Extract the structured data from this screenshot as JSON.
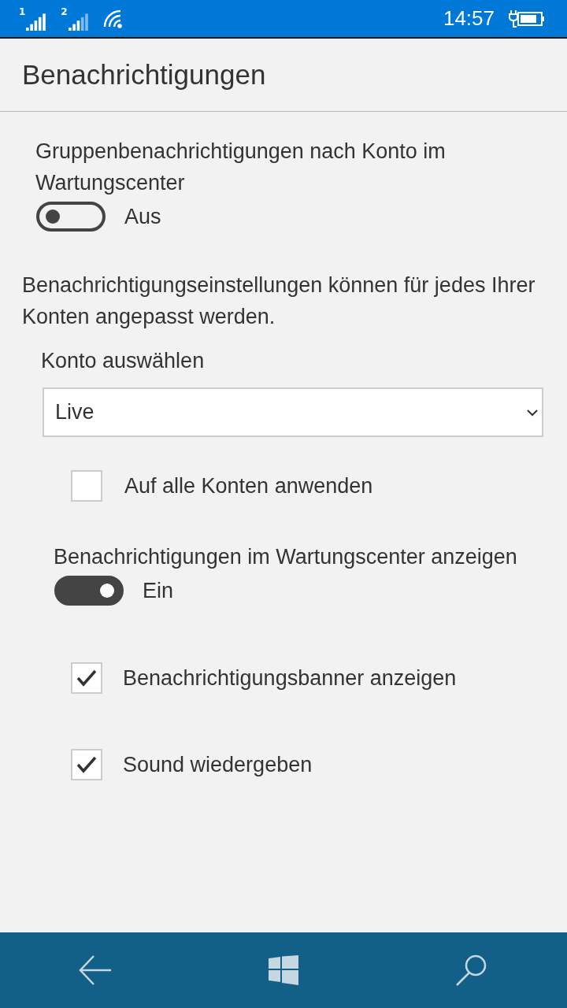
{
  "status_bar": {
    "sims": [
      {
        "label": "1"
      },
      {
        "label": "2"
      }
    ],
    "time": "14:57"
  },
  "title": "Benachrichtigungen",
  "group_toggle": {
    "label": "Gruppenbenachrichtigungen nach Konto im Wartungscenter",
    "on": false,
    "state_label": "Aus"
  },
  "description": "Benachrichtigungseinstellungen können für jedes Ihrer Konten angepasst werden.",
  "account": {
    "label": "Konto auswählen",
    "value": "Live"
  },
  "apply_all": {
    "label": "Auf alle Konten anwenden",
    "checked": false
  },
  "show_toggle": {
    "label": "Benachrichtigungen im Wartungscenter anzeigen",
    "on": true,
    "state_label": "Ein"
  },
  "options": [
    {
      "label": "Benachrichtigungsbanner anzeigen",
      "checked": true
    },
    {
      "label": "Sound wiedergeben",
      "checked": true
    }
  ]
}
